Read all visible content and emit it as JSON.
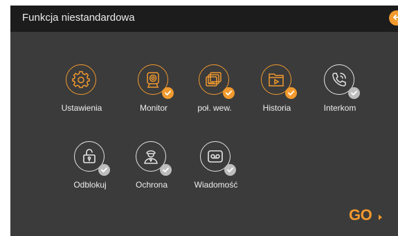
{
  "header": {
    "title": "Funkcja niestandardowa"
  },
  "colors": {
    "accent": "#f29a2e",
    "background": "#3b3b3b",
    "titlebar": "#1c1c1c",
    "check_gray": "#bdbdbd"
  },
  "tiles": [
    {
      "label": "Ustawienia",
      "icon": "gear-icon",
      "style": "orange",
      "check": "none"
    },
    {
      "label": "Monitor",
      "icon": "camera-icon",
      "style": "orange",
      "check": "orange"
    },
    {
      "label": "poł. wew.",
      "icon": "stacked-monitors-icon",
      "style": "orange",
      "check": "orange"
    },
    {
      "label": "Historia",
      "icon": "folder-video-icon",
      "style": "orange",
      "check": "orange"
    },
    {
      "label": "Interkom",
      "icon": "phone-icon",
      "style": "white",
      "check": "gray"
    },
    {
      "label": "Odblokuj",
      "icon": "unlock-icon",
      "style": "white",
      "check": "gray"
    },
    {
      "label": "Ochrona",
      "icon": "guard-icon",
      "style": "white",
      "check": "gray"
    },
    {
      "label": "Wiadomość",
      "icon": "voicemail-icon",
      "style": "white",
      "check": "gray"
    }
  ],
  "go_button": {
    "label": "GO"
  }
}
